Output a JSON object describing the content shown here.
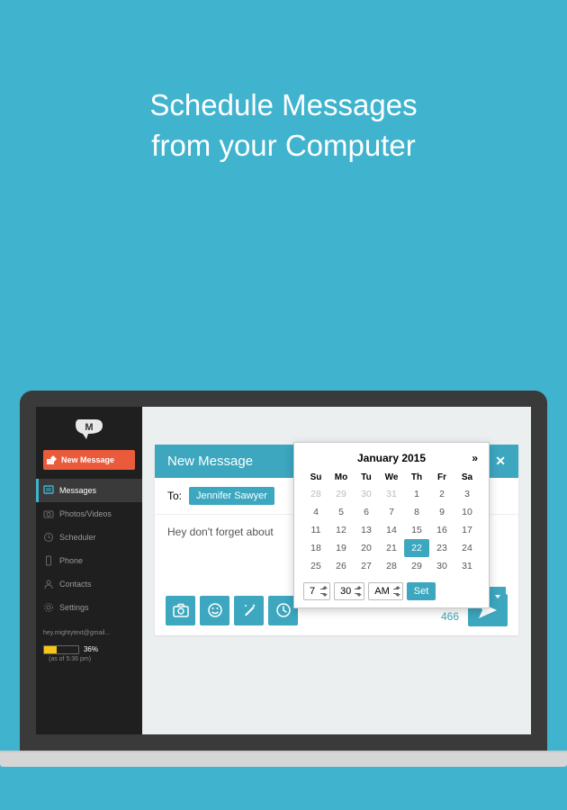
{
  "hero": {
    "line1": "Schedule Messages",
    "line2": "from your Computer"
  },
  "sidebar": {
    "new_message_label": "New Message",
    "items": [
      {
        "label": "Messages"
      },
      {
        "label": "Photos/Videos"
      },
      {
        "label": "Scheduler"
      },
      {
        "label": "Phone"
      },
      {
        "label": "Contacts"
      },
      {
        "label": "Settings"
      }
    ],
    "account_email": "hey.mightytext@gmail...",
    "battery_pct": "36%",
    "battery_note": "(as of 5:36 pm)"
  },
  "compose": {
    "title": "New Message",
    "to_label": "To:",
    "recipient": "Jennifer Sawyer",
    "body": "Hey don't forget about",
    "char_count": "466"
  },
  "calendar": {
    "title": "January 2015",
    "next": "»",
    "dow": [
      "Su",
      "Mo",
      "Tu",
      "We",
      "Th",
      "Fr",
      "Sa"
    ],
    "weeks": [
      [
        {
          "d": "28",
          "o": 1
        },
        {
          "d": "29",
          "o": 1
        },
        {
          "d": "30",
          "o": 1
        },
        {
          "d": "31",
          "o": 1
        },
        {
          "d": "1"
        },
        {
          "d": "2"
        },
        {
          "d": "3"
        }
      ],
      [
        {
          "d": "4"
        },
        {
          "d": "5"
        },
        {
          "d": "6"
        },
        {
          "d": "7"
        },
        {
          "d": "8"
        },
        {
          "d": "9"
        },
        {
          "d": "10"
        }
      ],
      [
        {
          "d": "11"
        },
        {
          "d": "12"
        },
        {
          "d": "13"
        },
        {
          "d": "14"
        },
        {
          "d": "15"
        },
        {
          "d": "16"
        },
        {
          "d": "17"
        }
      ],
      [
        {
          "d": "18"
        },
        {
          "d": "19"
        },
        {
          "d": "20"
        },
        {
          "d": "21"
        },
        {
          "d": "22",
          "sel": 1
        },
        {
          "d": "23"
        },
        {
          "d": "24"
        }
      ],
      [
        {
          "d": "25"
        },
        {
          "d": "26"
        },
        {
          "d": "27"
        },
        {
          "d": "28"
        },
        {
          "d": "29"
        },
        {
          "d": "30"
        },
        {
          "d": "31"
        }
      ]
    ],
    "hour": "7",
    "minute": "30",
    "ampm": "AM",
    "set_label": "Set"
  }
}
